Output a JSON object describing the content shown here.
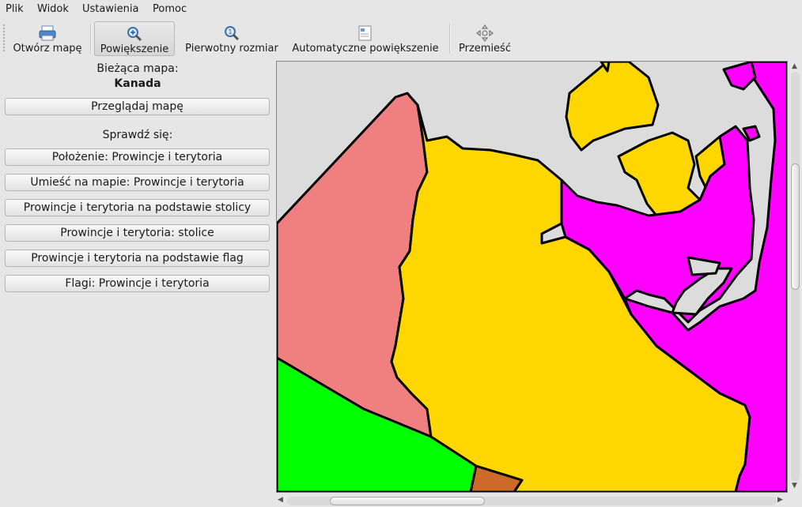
{
  "menubar": {
    "items": [
      {
        "label": "Plik"
      },
      {
        "label": "Widok"
      },
      {
        "label": "Ustawienia"
      },
      {
        "label": "Pomoc"
      }
    ]
  },
  "toolbar": {
    "open_map": {
      "label": "Otwórz mapę",
      "icon": "printer-icon"
    },
    "zoom": {
      "label": "Powiększenie",
      "icon": "zoom-in-icon",
      "active": true
    },
    "original_size": {
      "label": "Pierwotny rozmiar",
      "icon": "zoom-original-icon"
    },
    "auto_zoom": {
      "label": "Automatyczne powiększenie",
      "icon": "zoom-fit-icon"
    },
    "move": {
      "label": "Przemieść",
      "icon": "move-icon"
    }
  },
  "sidebar": {
    "current_map_label": "Bieżąca mapa:",
    "current_map_name": "Kanada",
    "browse_button": "Przeglądaj mapę",
    "quiz_heading": "Sprawdź się:",
    "quiz_buttons": [
      "Położenie: Prowincje i terytoria",
      "Umieść na mapie: Prowincje i terytoria",
      "Prowincje i terytoria na podstawie stolicy",
      "Prowincje i terytoria: stolice",
      "Prowincje i terytoria na podstawie flag",
      "Flagi: Prowincje i terytoria"
    ]
  },
  "map": {
    "colors": {
      "background": "#dcdcdc",
      "yukon": "#f08080",
      "northwest_territories": "#ffd700",
      "nunavut": "#ff00ff",
      "british_columbia": "#00ff00",
      "alberta": "#cd6a2a",
      "border": "#000000"
    }
  },
  "scrollbars": {
    "vertical_position": 0.22,
    "horizontal_position": 0.07
  }
}
